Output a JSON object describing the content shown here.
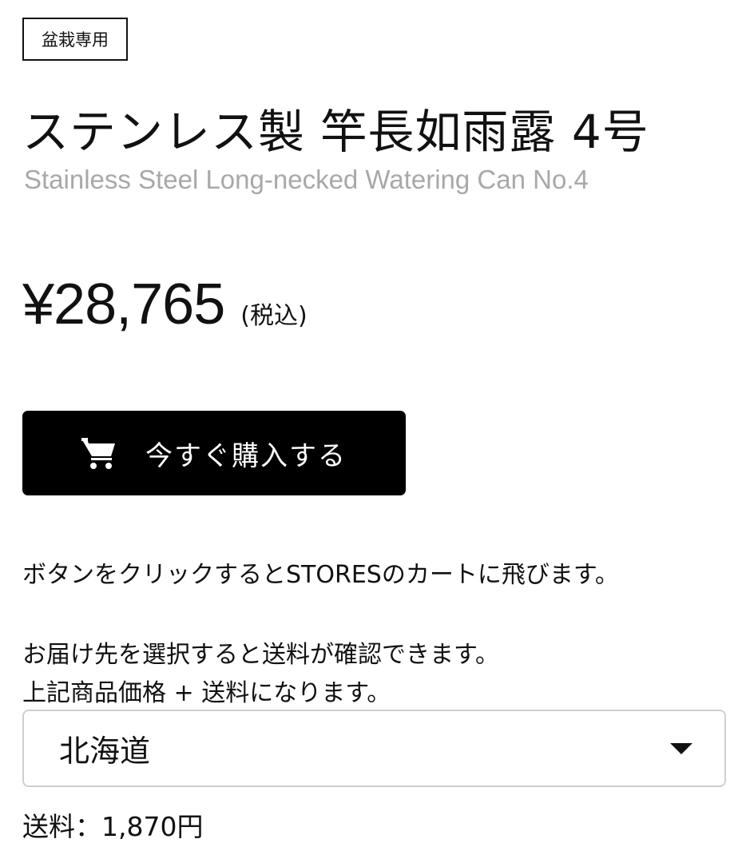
{
  "category_tag": "盆栽専用",
  "product": {
    "title": "ステンレス製 竿長如雨露 4号",
    "subtitle": "Stainless Steel Long-necked Watering Can No.4"
  },
  "price": {
    "value": "¥28,765",
    "tax_note": "(税込)"
  },
  "buy_button": {
    "label": "今すぐ購入する",
    "icon": "cart-icon"
  },
  "info": {
    "cart_notice": "ボタンをクリックするとSTORESのカートに飛びます。",
    "shipping_notice_1": "お届け先を選択すると送料が確認できます。",
    "shipping_notice_2": "上記商品価格 + 送料になります。"
  },
  "region_select": {
    "selected": "北海道",
    "icon": "caret-down-icon"
  },
  "shipping_fee": "送料：1,870円",
  "colors": {
    "button_background": "#000000",
    "subtitle_gray": "#a8a8a8",
    "select_border": "#cfcfcf"
  }
}
